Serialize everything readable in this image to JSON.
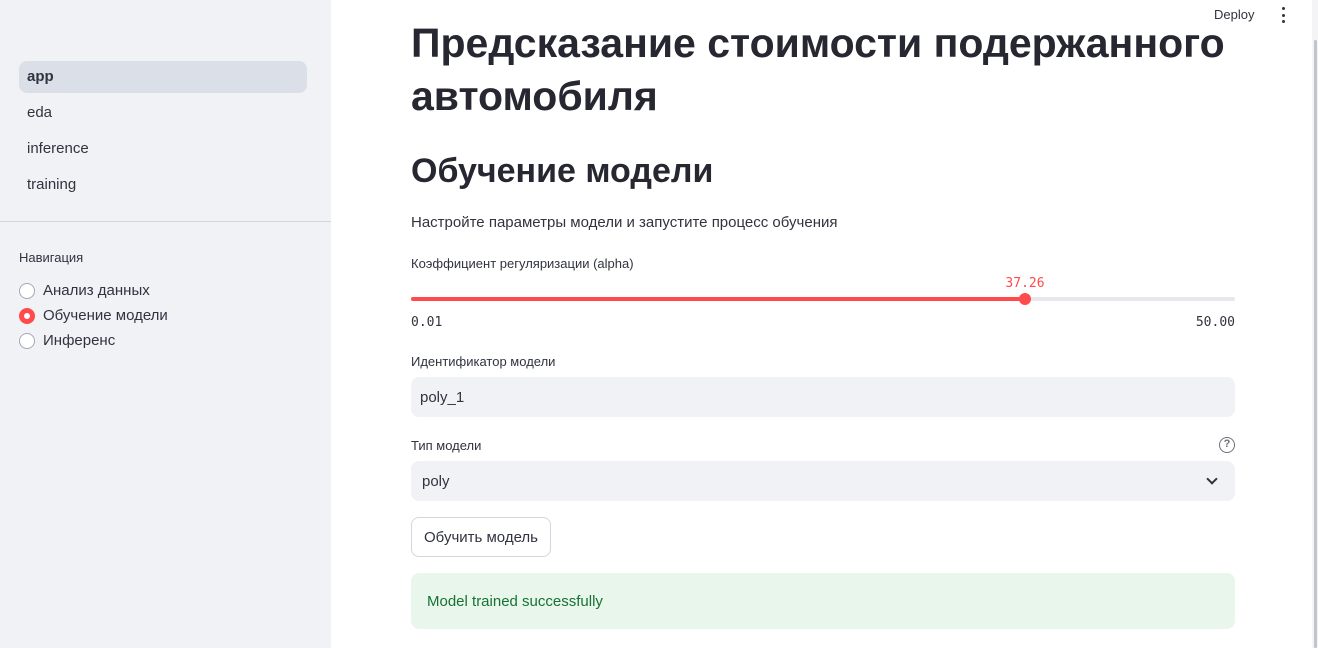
{
  "header": {
    "deploy_label": "Deploy",
    "menu_icon": "more-vertical-icon"
  },
  "sidebar": {
    "pages": [
      {
        "label": "app",
        "active": true
      },
      {
        "label": "eda",
        "active": false
      },
      {
        "label": "inference",
        "active": false
      },
      {
        "label": "training",
        "active": false
      }
    ],
    "nav_label": "Навигация",
    "radio_options": [
      {
        "label": "Анализ данных",
        "checked": false
      },
      {
        "label": "Обучение модели",
        "checked": true
      },
      {
        "label": "Инференс",
        "checked": false
      }
    ]
  },
  "main": {
    "title": "Предсказание стоимости подержанного автомобиля",
    "section_title": "Обучение модели",
    "subtitle": "Настройте параметры модели и запустите процесс обучения",
    "slider": {
      "label": "Коэффициент регуляризации (alpha)",
      "value": "37.26",
      "min": "0.01",
      "max": "50.00",
      "fill_fraction": 0.745
    },
    "model_id": {
      "label": "Идентификатор модели",
      "value": "poly_1"
    },
    "model_type": {
      "label": "Тип модели",
      "value": "poly",
      "help_icon": "question-circle-icon"
    },
    "train_button": "Обучить модель",
    "success_message": "Model trained successfully"
  },
  "colors": {
    "accent": "#ff4b4b",
    "sidebar_bg": "#f0f2f6",
    "success_bg": "#e8f6ec",
    "success_text": "#177233"
  }
}
